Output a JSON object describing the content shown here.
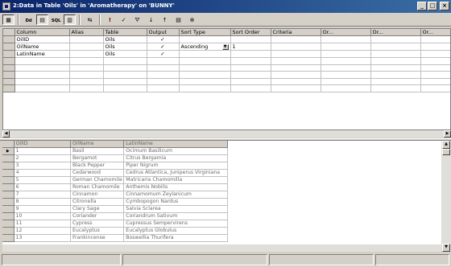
{
  "window": {
    "title": "2:Data in Table 'Oils' in 'Aromatherapy' on 'BUNNY'",
    "minimize": "_",
    "maximize": "□",
    "close": "×"
  },
  "toolbar": {
    "buttons": [
      {
        "icon": "grid-icon",
        "glyph": "▦"
      },
      {
        "icon": "diagram-pane-icon",
        "glyph": "Dd"
      },
      {
        "icon": "grid-pane-icon",
        "glyph": "▤"
      },
      {
        "icon": "sql-pane-icon",
        "glyph": "SQL"
      },
      {
        "icon": "results-pane-icon",
        "glyph": "▥"
      },
      {
        "icon": "change-query-type-icon",
        "glyph": "⇆"
      },
      {
        "icon": "run-icon",
        "glyph": "!"
      },
      {
        "icon": "verify-sql-icon",
        "glyph": "✓"
      },
      {
        "icon": "filter-icon",
        "glyph": "⛛"
      },
      {
        "icon": "sort-ascending-icon",
        "glyph": "↓"
      },
      {
        "icon": "sort-descending-icon",
        "glyph": "↑"
      },
      {
        "icon": "group-by-icon",
        "glyph": "▤"
      },
      {
        "icon": "add-table-icon",
        "glyph": "⊕"
      }
    ]
  },
  "criteria": {
    "columns": [
      "Column",
      "Alias",
      "Table",
      "Output",
      "Sort Type",
      "Sort Order",
      "Criteria",
      "Or...",
      "Or...",
      "Or..."
    ],
    "rows": [
      {
        "column": "OilID",
        "alias": "",
        "table": "Oils",
        "output": "✓",
        "sort_type": "",
        "sort_order": ""
      },
      {
        "column": "OilName",
        "alias": "",
        "table": "Oils",
        "output": "✓",
        "sort_type": "Ascending",
        "sort_order": "1"
      },
      {
        "column": "LatinName",
        "alias": "",
        "table": "Oils",
        "output": "✓",
        "sort_type": "",
        "sort_order": ""
      }
    ]
  },
  "results": {
    "columns": [
      "OilID",
      "OilName",
      "LatinName"
    ],
    "rows": [
      [
        "1",
        "Basil",
        "Ocimum Basilicum"
      ],
      [
        "2",
        "Bergamot",
        "Citrus Bergamia"
      ],
      [
        "3",
        "Black Pepper",
        "Piper Nigrum"
      ],
      [
        "4",
        "Cedarwood",
        "Cedrus Atlantica, Juniperus Virginiana"
      ],
      [
        "5",
        "German Chamomile",
        "Matricaria Chamomilla"
      ],
      [
        "6",
        "Roman Chamomile",
        "Anthemis Nobilis"
      ],
      [
        "7",
        "Cinnamon",
        "Cinnamomum Zeylanicum"
      ],
      [
        "8",
        "Citronella",
        "Cymbopogon Nardus"
      ],
      [
        "9",
        "Clary Sage",
        "Salvia Sclarea"
      ],
      [
        "10",
        "Coriander",
        "Coriandrum Sativum"
      ],
      [
        "11",
        "Cypress",
        "Cupressus Sempervirens"
      ],
      [
        "12",
        "Eucalyptus",
        "Eucalyptus Globulus"
      ],
      [
        "13",
        "Frankincense",
        "Boswellia Thurifera"
      ]
    ]
  },
  "colors": {
    "titlebar_start": "#0a246a",
    "titlebar_end": "#3a6ea5",
    "chrome": "#d4d0c8"
  }
}
